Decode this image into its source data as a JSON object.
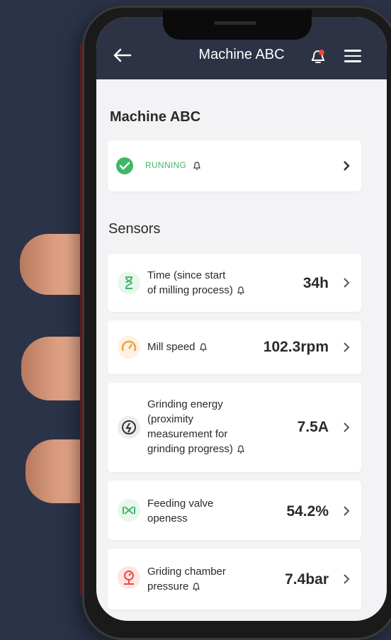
{
  "header": {
    "title": "Machine ABC",
    "back_icon": "arrow-left-icon",
    "bell_icon": "bell-alert-icon",
    "menu_icon": "menu-icon"
  },
  "machine": {
    "name": "Machine ABC",
    "status": "RUNNING",
    "status_color": "#3fb866"
  },
  "sensors": {
    "title": "Sensors",
    "items": [
      {
        "label": "Time (since start\nof milling process)",
        "value": "34h",
        "icon": "hourglass-icon"
      },
      {
        "label": "Mill speed",
        "value": "102.3rpm",
        "icon": "speedometer-icon"
      },
      {
        "label": "Grinding energy\n(proximity\nmeasurement for\ngrinding progress)",
        "value": "7.5A",
        "icon": "energy-icon"
      },
      {
        "label": "Feeding valve\nopeness",
        "value": "54.2%",
        "icon": "valve-icon"
      },
      {
        "label": "Griding chamber\npressure",
        "value": "7.4bar",
        "icon": "pressure-gauge-icon"
      }
    ]
  }
}
